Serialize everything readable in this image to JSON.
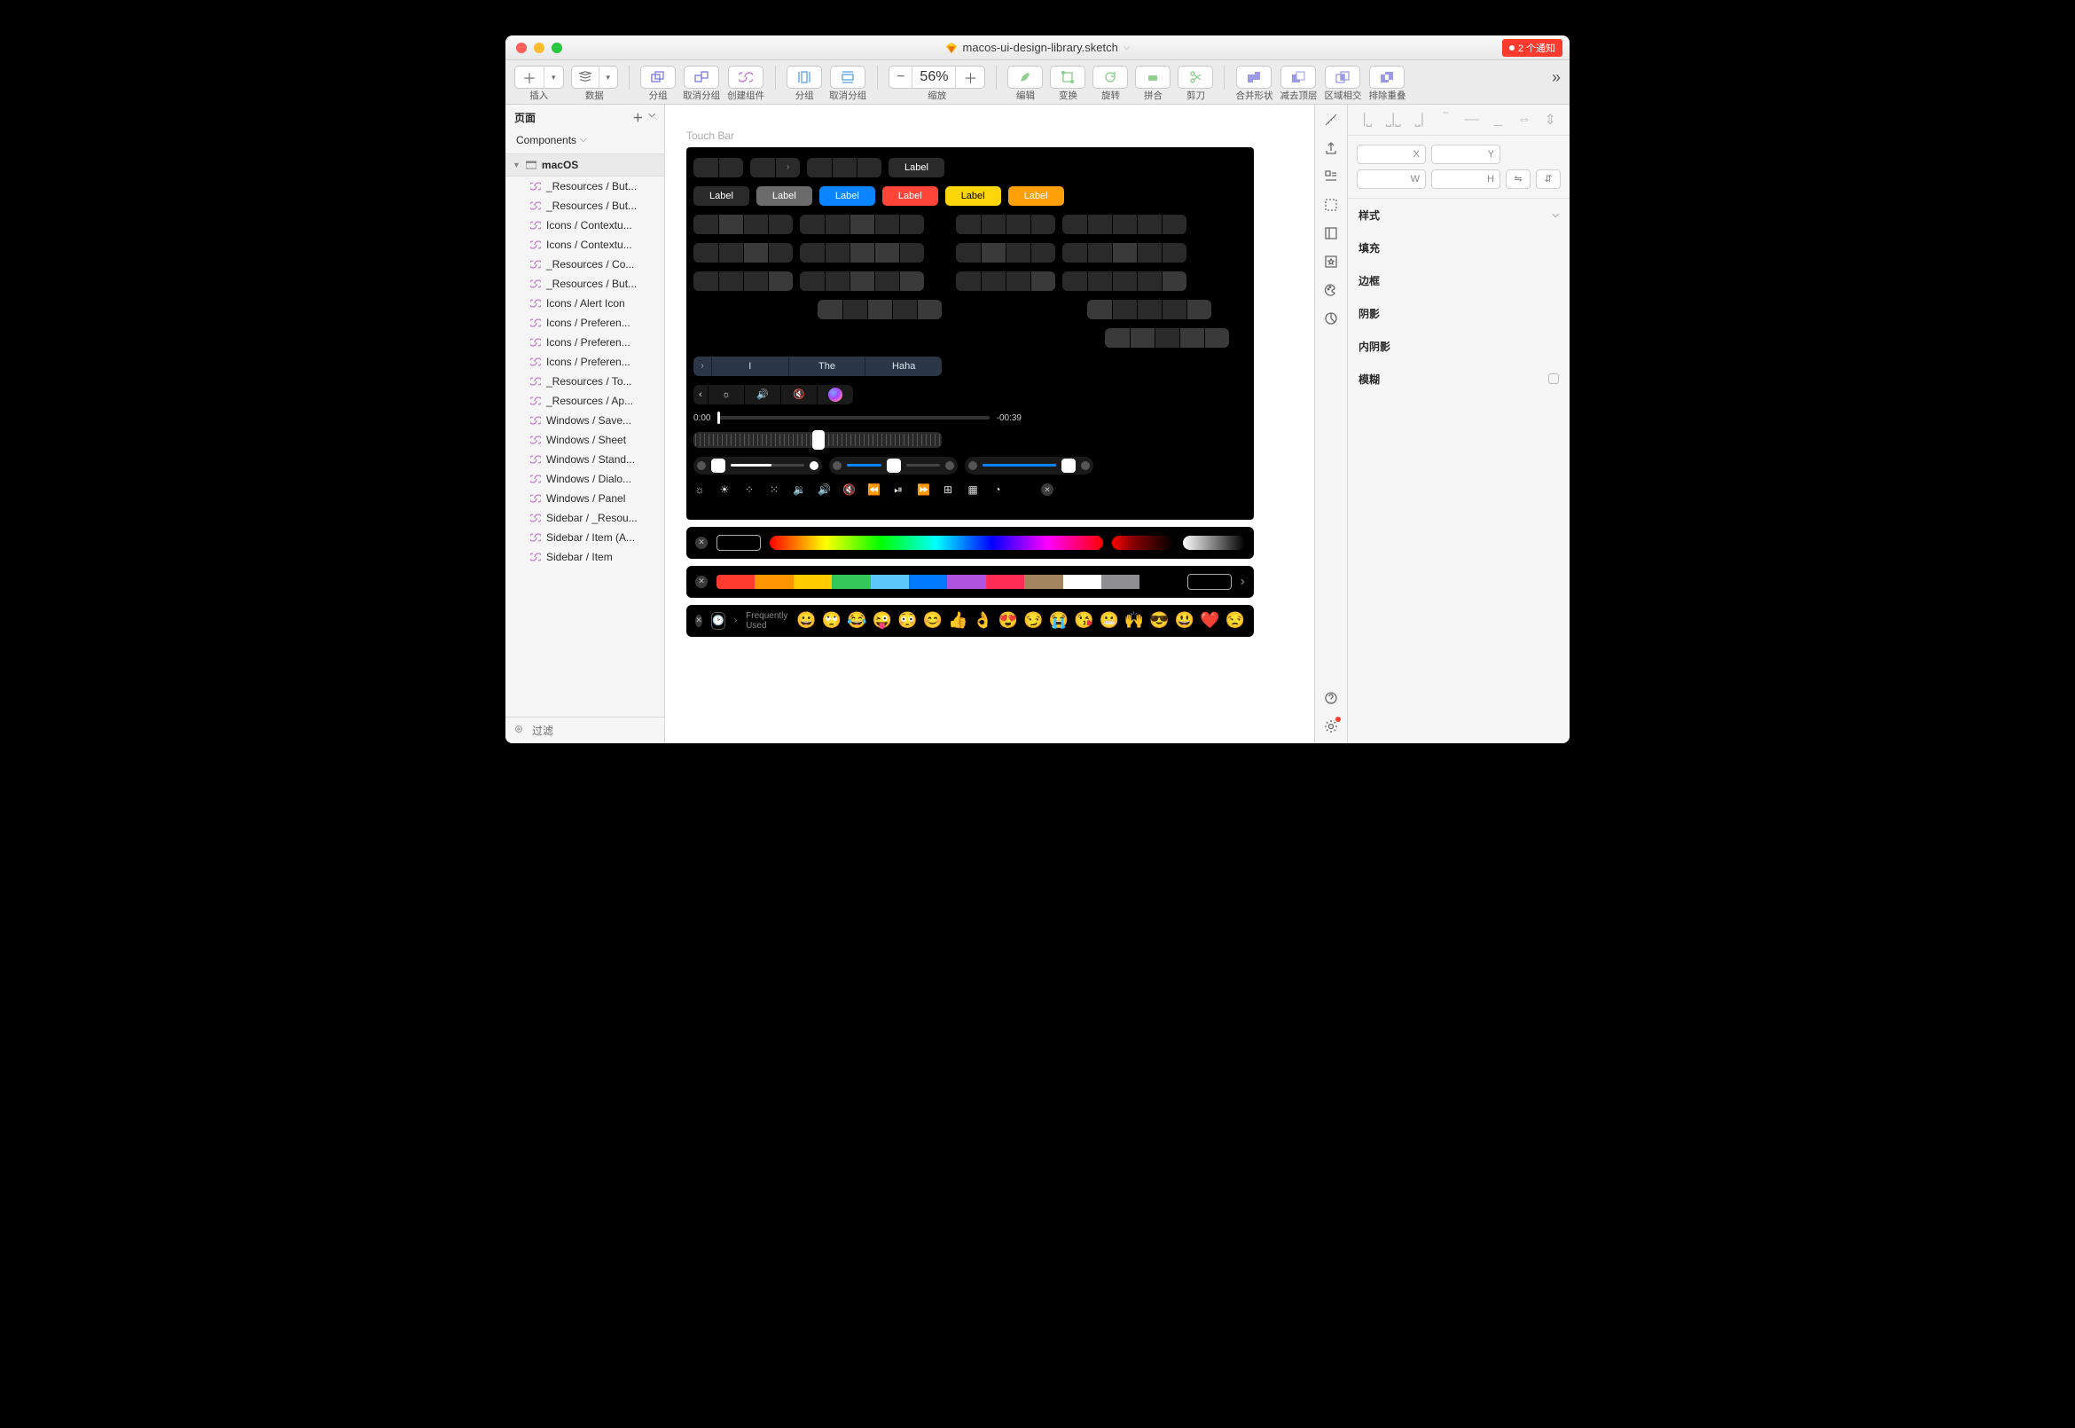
{
  "titlebar": {
    "filename": "macos-ui-design-library.sketch",
    "notification": "2 个通知"
  },
  "toolbar": {
    "insert": "插入",
    "data": "数据",
    "group": "分组",
    "ungroup": "取消分组",
    "create_symbol": "创建组件",
    "group2": "分组",
    "ungroup2": "取消分组",
    "zoom_label": "缩放",
    "zoom_value": "56%",
    "edit": "编辑",
    "transform": "变换",
    "rotate": "旋转",
    "union": "拼合",
    "scissors": "剪刀",
    "bool_union": "合并形状",
    "bool_subtract": "减去顶层",
    "bool_intersect": "区域相交",
    "bool_difference": "排除重叠"
  },
  "pages": {
    "header": "页面",
    "components": "Components",
    "artboard": "macOS"
  },
  "layers": [
    "_Resources / But...",
    "_Resources / But...",
    "Icons / Contextu...",
    "Icons / Contextu...",
    "_Resources / Co...",
    "_Resources / But...",
    "Icons / Alert Icon",
    "Icons / Preferen...",
    "Icons / Preferen...",
    "Icons / Preferen...",
    "_Resources / To...",
    "_Resources / Ap...",
    "Windows / Save...",
    "Windows / Sheet",
    "Windows / Stand...",
    "Windows / Dialo...",
    "Windows / Panel",
    "Sidebar / _Resou...",
    "Sidebar / Item (A...",
    "Sidebar / Item"
  ],
  "filter": "过滤",
  "canvas": {
    "title": "Touch Bar",
    "label": "Label",
    "predictive": {
      "i": "I",
      "the": "The",
      "haha": "Haha"
    },
    "time_start": "0:00",
    "time_end": "-00:39",
    "emoji_label": "Frequently Used",
    "emojis": [
      "😀",
      "🙄",
      "😂",
      "😜",
      "😳",
      "😊",
      "👍",
      "👌",
      "😍",
      "😏",
      "😭",
      "😘",
      "😬",
      "🙌",
      "😎",
      "😃",
      "❤️",
      "😒"
    ],
    "swatch_colors": [
      "#ff3b30",
      "#ff9500",
      "#ffcc00",
      "#34c759",
      "#5ac8fa",
      "#007aff",
      "#af52de",
      "#ff2d55",
      "#a2845e",
      "#ffffff",
      "#8e8e93",
      "#000000"
    ]
  },
  "inspector": {
    "x": "X",
    "y": "Y",
    "w": "W",
    "h": "H",
    "style": "样式",
    "fill": "填充",
    "border": "边框",
    "shadow": "阴影",
    "inner_shadow": "内阴影",
    "blur": "模糊"
  }
}
